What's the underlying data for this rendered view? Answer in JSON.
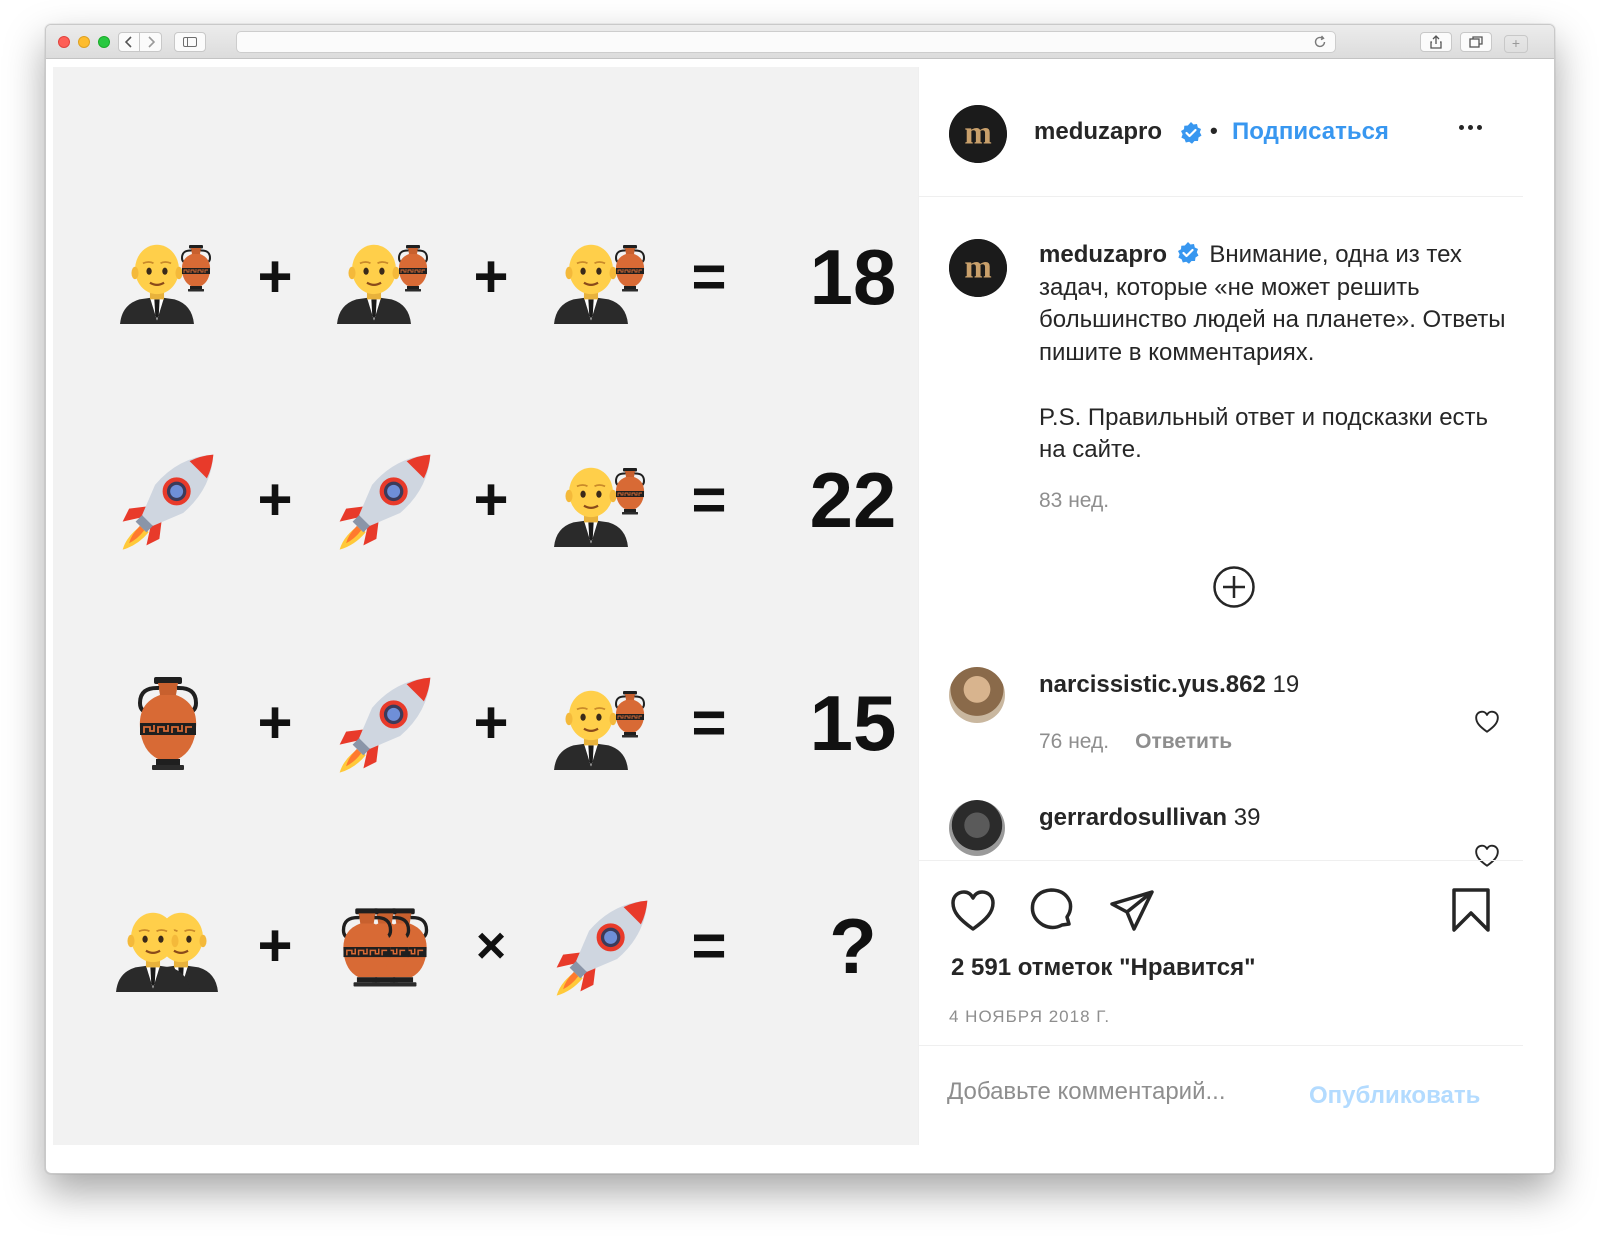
{
  "equations": [
    {
      "result": "18",
      "op1": "+",
      "op2": "+",
      "eq": "="
    },
    {
      "result": "22",
      "op1": "+",
      "op2": "+",
      "eq": "="
    },
    {
      "result": "15",
      "op1": "+",
      "op2": "+",
      "eq": "="
    },
    {
      "result": "?",
      "op1": "+",
      "op2": "×",
      "eq": "="
    }
  ],
  "header": {
    "username": "meduzapro",
    "separator": "•",
    "follow_label": "Подписаться"
  },
  "caption": {
    "username": "meduzapro",
    "text_line1": "Внимание, одна из тех задач, которые «не может решить большинство людей на планете». Ответы пишите в комментариях.",
    "text_line2": "P.S. Правильный ответ и подсказки есть на сайте.",
    "age": "83 нед."
  },
  "comments": [
    {
      "username": "narcissistic.yus.862",
      "text": "19",
      "age": "76 нед.",
      "reply_label": "Ответить"
    },
    {
      "username": "gerrardosullivan",
      "text": "39"
    }
  ],
  "likes_text": "2 591 отметок \"Нравится\"",
  "date_text": "4 НОЯБРЯ 2018 Г.",
  "comment_input": {
    "placeholder": "Добавьте комментарий..."
  },
  "publish_label": "Опубликовать",
  "colors": {
    "link_blue": "#3897f0",
    "publish_disabled": "#b3dbff",
    "muted": "#8e8e8e",
    "text": "#262626"
  },
  "icons": [
    "man-with-amphora-icon",
    "rocket-icon",
    "amphora-icon",
    "two-men-icon",
    "three-amphorae-icon",
    "heart-icon",
    "comment-icon",
    "share-icon",
    "bookmark-icon",
    "add-circle-icon",
    "verified-badge-icon",
    "more-options-icon"
  ]
}
